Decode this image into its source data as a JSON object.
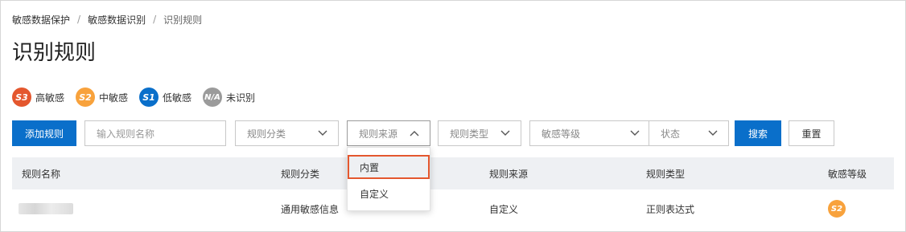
{
  "breadcrumb": {
    "items": [
      "敏感数据保护",
      "敏感数据识别",
      "识别规则"
    ],
    "separator": "/"
  },
  "page_title": "识别规则",
  "legend": [
    {
      "code": "S3",
      "label": "高敏感",
      "color": "#e4572e"
    },
    {
      "code": "S2",
      "label": "中敏感",
      "color": "#f8a23c"
    },
    {
      "code": "S1",
      "label": "低敏感",
      "color": "#0a6fca"
    },
    {
      "code": "N/A",
      "label": "未识别",
      "color": "#9b9b9b"
    }
  ],
  "toolbar": {
    "add_label": "添加规则",
    "search_placeholder": "输入规则名称",
    "filters": {
      "category": "规则分类",
      "source": "规则来源",
      "type": "规则类型",
      "level": "敏感等级",
      "status": "状态"
    },
    "search_label": "搜索",
    "reset_label": "重置"
  },
  "table": {
    "headers": [
      "规则名称",
      "规则分类",
      "规则来源",
      "规则类型",
      "敏感等级"
    ],
    "rows": [
      {
        "name": "",
        "category": "通用敏感信息",
        "source": "自定义",
        "type": "正则表达式",
        "level": "S2"
      }
    ]
  },
  "source_dropdown": {
    "options": [
      "内置",
      "自定义"
    ],
    "highlighted": "内置"
  },
  "icons": {
    "select_closed": "chevron-down-icon",
    "select_open": "chevron-up-icon"
  }
}
